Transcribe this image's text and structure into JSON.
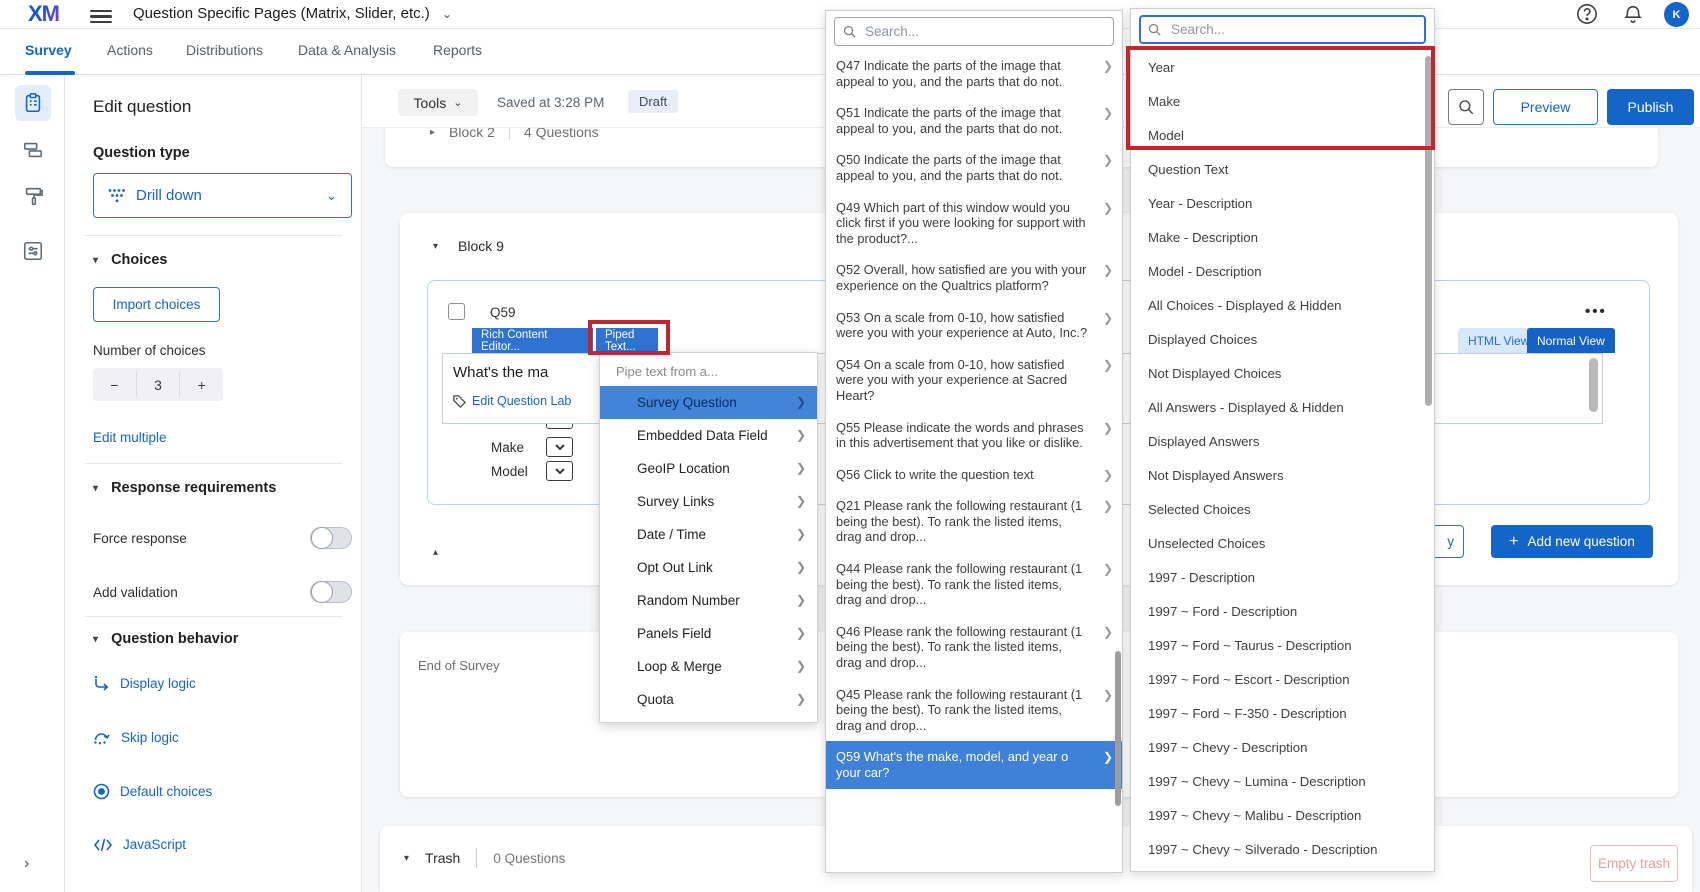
{
  "colors": {
    "brand_blue": "#1465c8",
    "toolbar_blue": "#2e72d2",
    "selection_blue": "#4285d8",
    "highlight_red": "#c2262e"
  },
  "topbar": {
    "logo": "XM",
    "title": "Question Specific Pages (Matrix, Slider, etc.)",
    "avatar_initial": "K"
  },
  "tabbar": {
    "tabs": [
      "Survey",
      "Actions",
      "Distributions",
      "Data & Analysis",
      "Reports"
    ],
    "active": "Survey"
  },
  "left_panel": {
    "title": "Edit question",
    "question_type": {
      "label": "Question type",
      "value": "Drill down"
    },
    "choices": {
      "header": "Choices",
      "import_button": "Import choices",
      "number_label": "Number of choices",
      "number_value": "3",
      "decrement": "−",
      "increment": "+",
      "edit_multiple_link": "Edit multiple"
    },
    "response_requirements": {
      "header": "Response requirements",
      "force_response_label": "Force response",
      "add_validation_label": "Add validation"
    },
    "question_behavior": {
      "header": "Question behavior",
      "display_logic": "Display logic",
      "skip_logic": "Skip logic",
      "default_choices": "Default choices",
      "javascript": "JavaScript"
    }
  },
  "canvas": {
    "tools_button": "Tools",
    "saved_status": "Saved at 3:28 PM",
    "draft_badge": "Draft",
    "partial_block": {
      "name": "Block 2",
      "count": "4 Questions"
    },
    "block9": {
      "name": "Block 9",
      "question_id": "Q59",
      "rich_content_editor_tab": "Rich Content Editor...",
      "piped_text_tab": "Piped Text...",
      "html_view_tab": "HTML View",
      "normal_view_tab": "Normal View",
      "question_text_visible": "What's the ma",
      "edit_question_label": "Edit Question Lab",
      "field_rows": [
        "Make",
        "Model"
      ],
      "copy_button_visible": "y",
      "add_new_question_button": "Add new question"
    },
    "end_of_survey": "End of Survey",
    "trash": {
      "label": "Trash",
      "count": "0 Questions",
      "empty_button": "Empty trash"
    }
  },
  "header_actions": {
    "preview_button": "Preview",
    "publish_button": "Publish"
  },
  "pipe_menu": {
    "header": "Pipe text from a...",
    "selected": "Survey Question",
    "items": [
      "Survey Question",
      "Embedded Data Field",
      "GeoIP Location",
      "Survey Links",
      "Date / Time",
      "Opt Out Link",
      "Random Number",
      "Panels Field",
      "Loop & Merge",
      "Quota"
    ]
  },
  "question_list_panel": {
    "search_placeholder": "Search...",
    "selected": "Q59 What's the make, model, and year o your car?",
    "items": [
      "Q47 Indicate the parts of the image that appeal to you, and the parts that do not.",
      "Q51 Indicate the parts of the image that appeal to you, and the parts that do not.",
      "Q50 Indicate the parts of the image that appeal to you, and the parts that do not.",
      "Q49 Which part of this window would you click first if you were looking for support with the product?...",
      "Q52 Overall, how satisfied are you with your experience on the Qualtrics platform?",
      "Q53 On a scale from 0-10, how satisfied were you with your experience at Auto, Inc.?",
      "Q54 On a scale from 0-10, how satisfied were you with your experience at Sacred Heart?",
      "Q55 Please indicate the words and phrases in this advertisement that you like or dislike.",
      "Q56 Click to write the question text",
      "Q21 Please rank the following restaurant (1 being the best). To rank the listed items, drag and drop...",
      "Q44 Please rank the following restaurant (1 being the best). To rank the listed items, drag and drop...",
      "Q46 Please rank the following restaurant (1 being the best). To rank the listed items, drag and drop...",
      "Q45 Please rank the following restaurant (1 being the best). To rank the listed items, drag and drop...",
      "Q59 What's the make, model, and year o your car?"
    ]
  },
  "field_list_panel": {
    "search_placeholder": "Search...",
    "red_boxed_items": [
      "Year",
      "Make",
      "Model"
    ],
    "items": [
      "Year",
      "Make",
      "Model",
      "Question Text",
      "Year - Description",
      "Make - Description",
      "Model - Description",
      "All Choices - Displayed & Hidden",
      "Displayed Choices",
      "Not Displayed Choices",
      "All Answers - Displayed & Hidden",
      "Displayed Answers",
      "Not Displayed Answers",
      "Selected Choices",
      "Unselected Choices",
      "1997 - Description",
      "1997 ~ Ford - Description",
      "1997 ~ Ford ~ Taurus - Description",
      "1997 ~ Ford ~ Escort - Description",
      "1997 ~ Ford ~ F-350 - Description",
      "1997 ~ Chevy - Description",
      "1997 ~ Chevy ~ Lumina - Description",
      "1997 ~ Chevy ~ Malibu - Description",
      "1997 ~ Chevy ~ Silverado - Description"
    ]
  }
}
